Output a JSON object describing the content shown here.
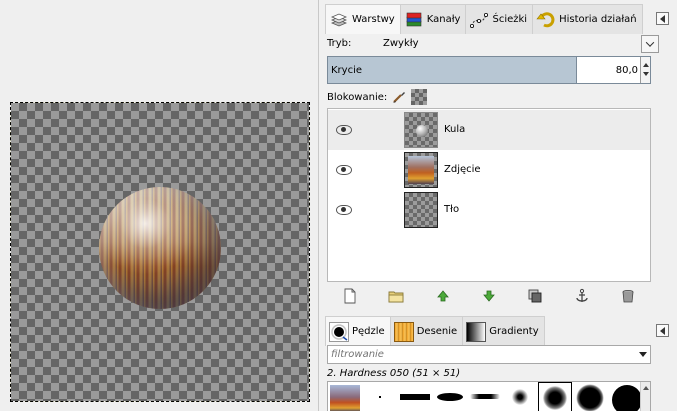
{
  "layers_dock": {
    "tabs": [
      {
        "label": "Warstwy",
        "icon": "layers-icon",
        "active": true
      },
      {
        "label": "Kanały",
        "icon": "channels-icon",
        "active": false
      },
      {
        "label": "Ścieżki",
        "icon": "paths-icon",
        "active": false
      },
      {
        "label": "Historia działań",
        "icon": "undo-history-icon",
        "active": false
      }
    ],
    "mode_label": "Tryb:",
    "mode_value": "Zwykły",
    "opacity_label": "Krycie",
    "opacity_value": "80,0",
    "opacity_fraction": 0.8,
    "lock_label": "Blokowanie:",
    "layers": [
      {
        "name": "Kula",
        "visible": true,
        "selected": true,
        "thumb": "sphere"
      },
      {
        "name": "Zdjęcie",
        "visible": true,
        "selected": false,
        "thumb": "photo"
      },
      {
        "name": "Tło",
        "visible": true,
        "selected": false,
        "thumb": "transparent"
      }
    ],
    "toolbar_icons": [
      "new-layer-icon",
      "new-layer-group-icon",
      "raise-layer-icon",
      "lower-layer-icon",
      "duplicate-layer-icon",
      "anchor-layer-icon",
      "delete-layer-icon"
    ]
  },
  "brushes_dock": {
    "tabs": [
      {
        "label": "Pędzle",
        "icon": "brushes-icon",
        "active": true
      },
      {
        "label": "Desenie",
        "icon": "patterns-icon",
        "active": false
      },
      {
        "label": "Gradienty",
        "icon": "gradients-icon",
        "active": false
      }
    ],
    "filter_placeholder": "filtrowanie",
    "brush_name": "2. Hardness 050 (51 × 51)"
  },
  "colors": {
    "selection_bg": "#ececec",
    "opacity_fill": "#b7c6d3",
    "canvas_outline": "#e3d200"
  }
}
